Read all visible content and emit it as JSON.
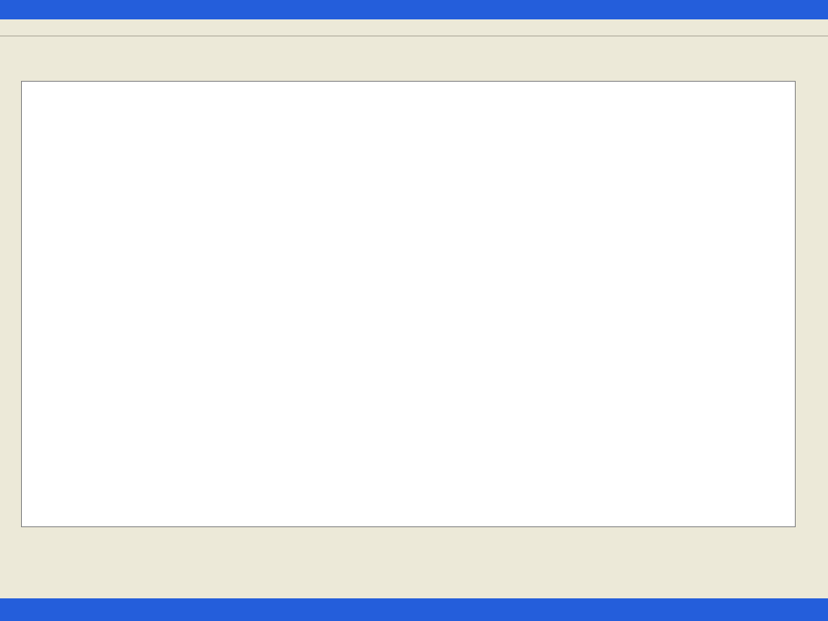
{
  "window": {
    "title": ""
  },
  "menu": {
    "file": ""
  },
  "statusbar": {
    "coords": ""
  },
  "taskbar": {
    "start": ""
  }
}
